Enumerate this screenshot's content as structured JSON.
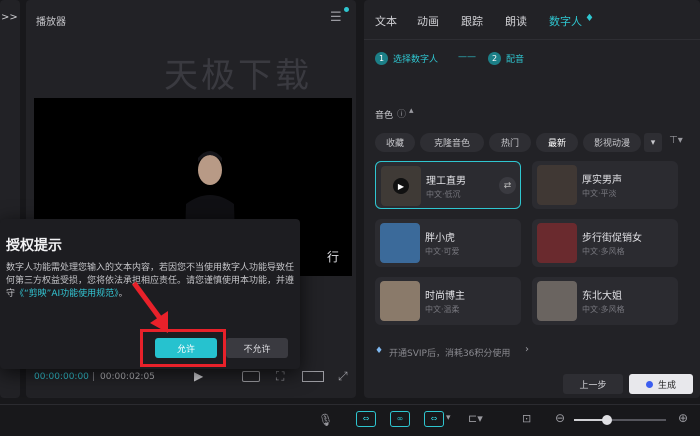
{
  "left_strip": {
    "collapse_glyph": ">>"
  },
  "player": {
    "title": "播放器",
    "watermark": "天极下载",
    "time_current": "00:00:00:00",
    "time_total": "00:00:02:05",
    "caption_partial": "行"
  },
  "right": {
    "tabs": [
      "文本",
      "动画",
      "跟踪",
      "朗读",
      "数字人"
    ],
    "steps": [
      {
        "num": "1",
        "label": "选择数字人"
      },
      {
        "num": "2",
        "label": "配音"
      }
    ],
    "section_label": "音色",
    "chips": [
      "收藏",
      "克隆音色",
      "热门",
      "最新",
      "影视动漫"
    ],
    "cards": [
      {
        "name": "理工直男",
        "sub": "中文·低沉"
      },
      {
        "name": "厚实男声",
        "sub": "中文·平淡"
      },
      {
        "name": "胖小虎",
        "sub": "中文·可爱"
      },
      {
        "name": "步行街促销女",
        "sub": "中文·多风格"
      },
      {
        "name": "时尚博主",
        "sub": "中文·温柔"
      },
      {
        "name": "东北大姐",
        "sub": "中文·多风格"
      }
    ],
    "svip_text": "开通SVIP后，消耗36积分使用",
    "prev_button": "上一步",
    "generate_button": "生成"
  },
  "dialog": {
    "title": "授权提示",
    "body_1": "数字人功能需处理您输入的文本内容，若因您不当使用数字人功能导致任何第三方权益受损，您将依法承担相应责任。请您谨慎使用本功能，并遵守",
    "link": "《“剪映”AI功能使用规范》",
    "body_end": "。",
    "allow_button": "允许",
    "deny_button": "不允许"
  },
  "colors": {
    "accent": "#2fc6d0",
    "highlight_red": "#e8212a"
  }
}
